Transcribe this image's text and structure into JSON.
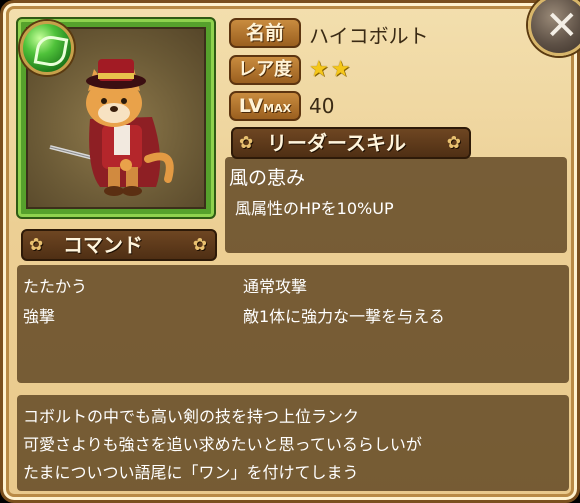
{
  "character": {
    "name_label": "名前",
    "name": "ハイコボルト",
    "rarity_label": "レア度",
    "rarity_stars": 2,
    "rarity_display": "★★",
    "level_label": "LV",
    "level_max_tag": "MAX",
    "level": "40"
  },
  "leader_skill": {
    "header": "リーダースキル",
    "name": "風の恵み",
    "description": "風属性のHPを10%UP"
  },
  "commands": {
    "header": "コマンド",
    "items": [
      {
        "name": "たたかう",
        "description": "通常攻撃"
      },
      {
        "name": "強撃",
        "description": "敵1体に強力な一撃を与える"
      }
    ]
  },
  "flavor": {
    "lines": [
      "コボルトの中でも高い剣の技を持つ上位ランク",
      "可愛さよりも強さを追い求めたいと思っているらしいが",
      "たまについつい語尾に「ワン」を付けてしまう"
    ]
  },
  "icons": {
    "element": "wind-element-orb-icon",
    "close": "close-icon",
    "portrait": "kobold-swordsman-portrait"
  },
  "colors": {
    "panel": "#eccf94",
    "box": "#5d4321",
    "star": "#f5c71a",
    "element": "#4fc23a"
  }
}
